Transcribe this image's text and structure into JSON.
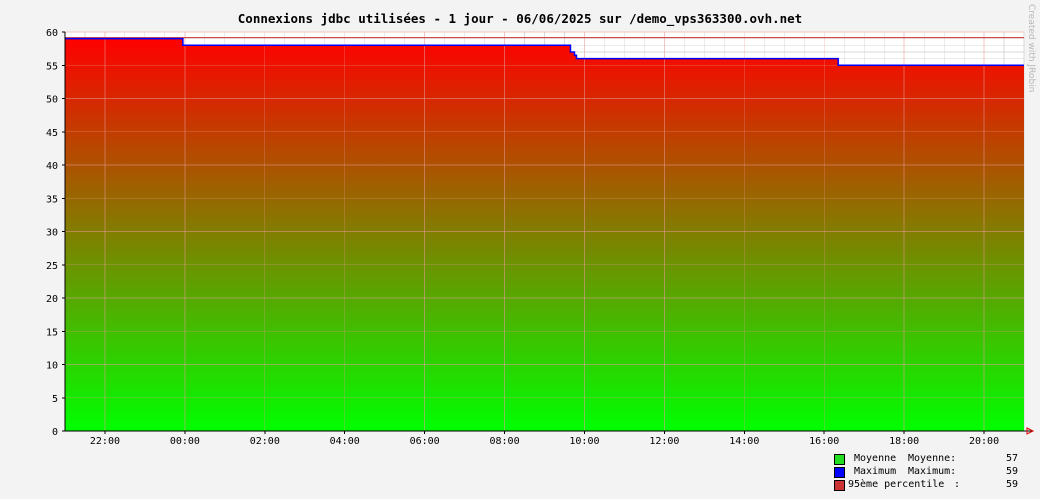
{
  "chart_data": {
    "type": "area",
    "title": "Connexions jdbc utilisées - 1 jour - 06/06/2025 sur /demo_vps363300.ovh.net",
    "ylim": [
      0,
      60
    ],
    "yticks": [
      0,
      5,
      10,
      15,
      20,
      25,
      30,
      35,
      40,
      45,
      50,
      55,
      60
    ],
    "xlim": [
      -3,
      21
    ],
    "xticks": [
      {
        "label": "22:00",
        "x": -2
      },
      {
        "label": "00:00",
        "x": 0
      },
      {
        "label": "02:00",
        "x": 2
      },
      {
        "label": "04:00",
        "x": 4
      },
      {
        "label": "06:00",
        "x": 6
      },
      {
        "label": "08:00",
        "x": 8
      },
      {
        "label": "10:00",
        "x": 10
      },
      {
        "label": "12:00",
        "x": 12
      },
      {
        "label": "14:00",
        "x": 14
      },
      {
        "label": "16:00",
        "x": 16
      },
      {
        "label": "18:00",
        "x": 18
      },
      {
        "label": "20:00",
        "x": 20
      }
    ],
    "grid": true,
    "series": [
      {
        "name": "Moyenne",
        "color": "#00ff00",
        "x": [
          -3,
          -0.05,
          -0.05,
          9.65,
          9.65,
          9.75,
          9.75,
          9.8,
          9.8,
          16.35,
          16.35,
          21
        ],
        "y": [
          59,
          59,
          58,
          58,
          57,
          57,
          56.5,
          56.5,
          56,
          56,
          55,
          55
        ]
      },
      {
        "name": "Maximum",
        "color": "#0000ff",
        "x": [
          -3,
          -0.05,
          -0.05,
          9.65,
          9.65,
          9.75,
          9.75,
          9.8,
          9.8,
          16.35,
          16.35,
          21
        ],
        "y": [
          59,
          59,
          58,
          58,
          57,
          57,
          56.5,
          56.5,
          56,
          56,
          55,
          55
        ]
      }
    ],
    "percentile_line": {
      "name": "95ème percentile",
      "value": 59,
      "color": "#cc3333"
    },
    "gradient_colors": {
      "top": "#ff0000",
      "bottom": "#00ff00"
    },
    "legend": {
      "placement": "bottom-right",
      "items": [
        {
          "name": "Moyenne",
          "label": "Moyenne:",
          "value": "57",
          "color": "#22dd22"
        },
        {
          "name": "Maximum",
          "label": "Maximum:",
          "value": "59",
          "color": "#0000ff"
        },
        {
          "name": "95ème percentile",
          "label": ":",
          "value": "59",
          "color": "#cc3333"
        }
      ]
    }
  },
  "watermark": "Created with JRobin"
}
